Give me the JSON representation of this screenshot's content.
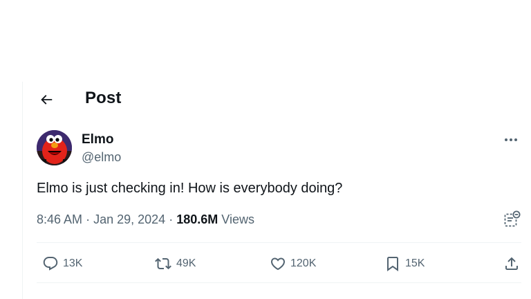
{
  "header": {
    "title": "Post",
    "back_icon": "arrow-left-icon"
  },
  "post": {
    "author": {
      "display_name": "Elmo",
      "handle": "@elmo",
      "avatar_icon": "elmo-avatar"
    },
    "text": "Elmo is just checking in! How is everybody doing?",
    "time": "8:46 AM",
    "date": "Jan 29, 2024",
    "views_count": "180.6M",
    "views_label": "Views",
    "separator": "·"
  },
  "actions": {
    "replies": "13K",
    "reposts": "49K",
    "likes": "120K",
    "bookmarks": "15K"
  },
  "colors": {
    "text_primary": "#0f1419",
    "text_secondary": "#536471",
    "divider": "#eff3f4"
  }
}
